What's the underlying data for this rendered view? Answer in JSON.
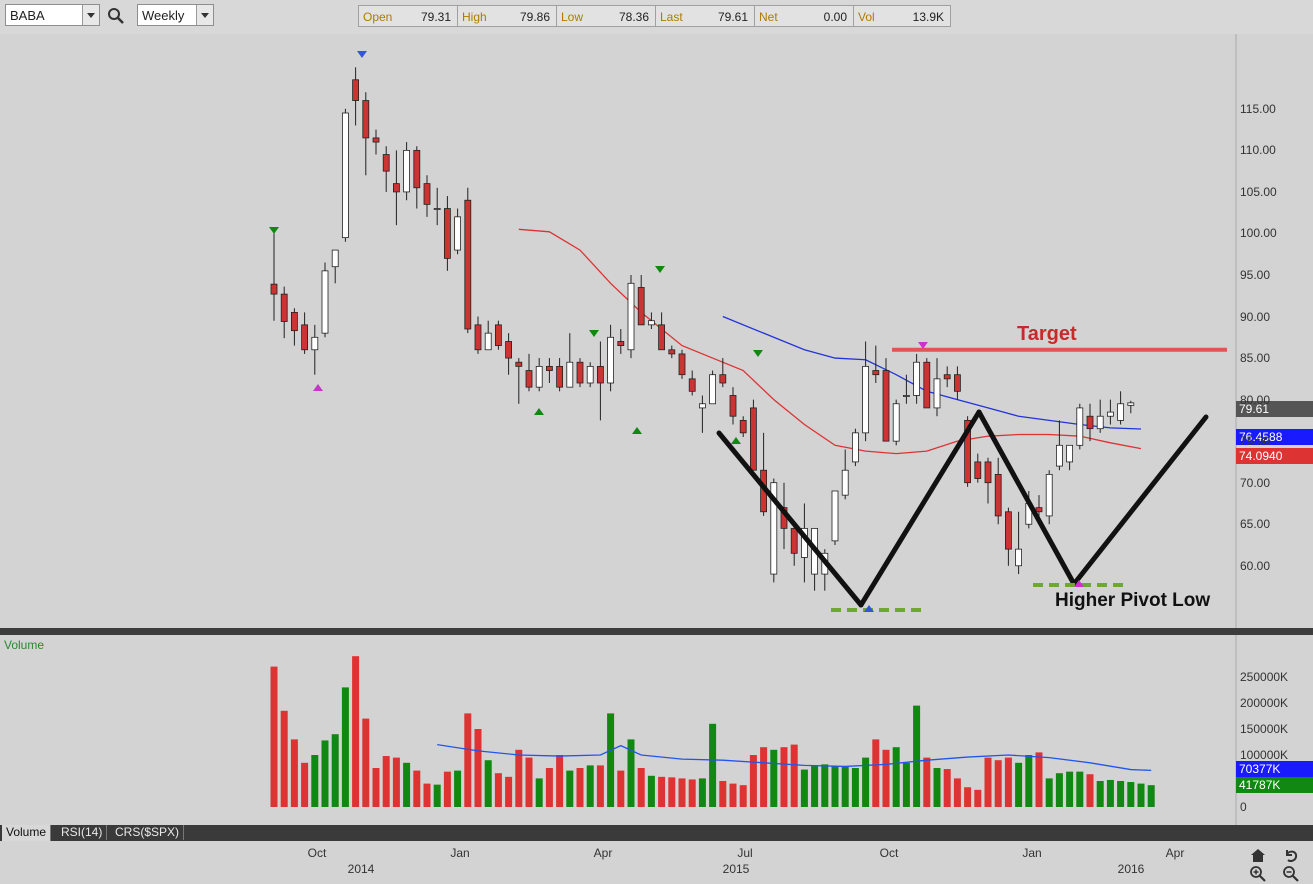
{
  "toolbar": {
    "symbol": "BABA",
    "period": "Weekly",
    "quote": [
      {
        "label": "Open",
        "value": "79.31"
      },
      {
        "label": "High",
        "value": "79.86"
      },
      {
        "label": "Low",
        "value": "78.36"
      },
      {
        "label": "Last",
        "value": "79.61"
      },
      {
        "label": "Net",
        "value": "0.00"
      },
      {
        "label": "Vol",
        "value": "13.9K"
      }
    ]
  },
  "colors": {
    "up": "#ffffff",
    "down": "#cc3333",
    "ma_blue": "#2233dd",
    "ma_red": "#dd3333",
    "vol_up": "#118811",
    "vol_down": "#dd3333",
    "target_line": "#e05555",
    "pivot_dash": "#6ea832"
  },
  "price_axis": {
    "ticks": [
      "115.00",
      "110.00",
      "105.00",
      "100.00",
      "95.00",
      "90.00",
      "85.00",
      "80.00",
      "75.00",
      "70.00",
      "65.00",
      "60.00"
    ],
    "min": 56,
    "max": 121
  },
  "price_tags": {
    "last": "79.61",
    "ma_blue": "76.4588",
    "ma_red": "74.0940"
  },
  "volume_panel": {
    "title": "Volume",
    "ticks": [
      "250000K",
      "200000K",
      "150000K",
      "100000K",
      "0"
    ],
    "avg_tag": "70377K",
    "last_tag": "41787K",
    "max": 300000
  },
  "annotations": {
    "target": "Target",
    "pivot": "Higher Pivot Low"
  },
  "tabs": [
    "Volume",
    "RSI(14)",
    "CRS($SPX)"
  ],
  "time_axis": {
    "months": [
      "Oct",
      "Jan",
      "Apr",
      "Jul",
      "Oct",
      "Jan",
      "Apr"
    ],
    "years": [
      "2014",
      "2015",
      "2016"
    ]
  },
  "icons": [
    "search-icon",
    "home-icon",
    "undo-icon",
    "zoom-in-icon",
    "zoom-out-icon"
  ],
  "chart_data": {
    "type": "candlestick",
    "x_labels": [
      "Oct",
      "Jan",
      "Apr",
      "Jul",
      "Oct",
      "Jan",
      "Apr"
    ],
    "ohlc": [
      [
        93.9,
        100.0,
        89.5,
        92.7
      ],
      [
        92.7,
        93.6,
        87.4,
        89.4
      ],
      [
        90.5,
        91.0,
        86.5,
        88.3
      ],
      [
        89.0,
        90.5,
        85.5,
        86.0
      ],
      [
        86.0,
        89.0,
        83.0,
        87.5
      ],
      [
        88.0,
        96.5,
        87.5,
        95.5
      ],
      [
        96.0,
        97.5,
        94.0,
        98.0
      ],
      [
        99.5,
        115.0,
        99.0,
        114.5
      ],
      [
        118.5,
        120.0,
        113.0,
        116.0
      ],
      [
        116.0,
        117.0,
        107.0,
        111.5
      ],
      [
        111.5,
        112.5,
        109.5,
        111.0
      ],
      [
        109.5,
        110.5,
        105.0,
        107.5
      ],
      [
        106.0,
        110.0,
        101.0,
        105.0
      ],
      [
        105.0,
        111.0,
        104.0,
        110.0
      ],
      [
        110.0,
        110.5,
        103.0,
        105.5
      ],
      [
        106.0,
        107.0,
        102.0,
        103.5
      ],
      [
        103.0,
        105.5,
        101.0,
        103.0
      ],
      [
        103.0,
        104.5,
        95.5,
        97.0
      ],
      [
        98.0,
        103.0,
        97.5,
        102.0
      ],
      [
        104.0,
        105.5,
        88.0,
        88.5
      ],
      [
        89.0,
        90.0,
        85.5,
        86.0
      ],
      [
        86.0,
        89.5,
        86.0,
        88.0
      ],
      [
        89.0,
        89.5,
        86.0,
        86.5
      ],
      [
        87.0,
        88.0,
        83.0,
        85.0
      ],
      [
        84.5,
        85.0,
        79.5,
        84.0
      ],
      [
        83.5,
        85.5,
        81.0,
        81.5
      ],
      [
        81.5,
        85.0,
        81.0,
        84.0
      ],
      [
        84.0,
        85.0,
        82.0,
        83.5
      ],
      [
        84.0,
        85.0,
        81.0,
        81.5
      ],
      [
        81.5,
        88.0,
        81.5,
        84.5
      ],
      [
        84.5,
        85.0,
        81.5,
        82.0
      ],
      [
        82.0,
        84.5,
        81.5,
        84.0
      ],
      [
        84.0,
        87.0,
        77.5,
        82.0
      ],
      [
        82.0,
        89.0,
        81.0,
        87.5
      ],
      [
        87.0,
        88.5,
        85.5,
        86.5
      ],
      [
        86.0,
        95.0,
        85.0,
        94.0
      ],
      [
        93.5,
        95.0,
        89.5,
        89.0
      ],
      [
        89.0,
        90.5,
        88.5,
        89.5
      ],
      [
        89.0,
        90.5,
        86.5,
        86.0
      ],
      [
        86.0,
        86.5,
        85.0,
        85.5
      ],
      [
        85.5,
        86.0,
        82.5,
        83.0
      ],
      [
        82.5,
        83.5,
        80.5,
        81.0
      ],
      [
        79.0,
        80.5,
        76.0,
        79.5
      ],
      [
        79.5,
        83.5,
        79.5,
        83.0
      ],
      [
        83.0,
        85.0,
        81.5,
        82.0
      ],
      [
        80.5,
        81.5,
        77.0,
        78.0
      ],
      [
        77.5,
        78.0,
        75.5,
        76.0
      ],
      [
        79.0,
        80.0,
        71.5,
        71.5
      ],
      [
        71.5,
        76.0,
        66.0,
        66.5
      ],
      [
        59.0,
        70.5,
        58.0,
        70.0
      ],
      [
        67.0,
        70.0,
        62.0,
        64.5
      ],
      [
        64.5,
        65.0,
        60.0,
        61.5
      ],
      [
        61.0,
        67.5,
        58.0,
        64.5
      ],
      [
        59.0,
        64.5,
        57.0,
        64.5
      ],
      [
        59.0,
        62.0,
        57.0,
        61.5
      ],
      [
        63.0,
        69.0,
        62.5,
        69.0
      ],
      [
        68.5,
        74.0,
        68.0,
        71.5
      ],
      [
        72.5,
        76.5,
        72.0,
        76.0
      ],
      [
        76.0,
        87.0,
        75.0,
        84.0
      ],
      [
        83.5,
        86.5,
        82.0,
        83.0
      ],
      [
        83.5,
        85.0,
        75.0,
        75.0
      ],
      [
        75.0,
        80.0,
        74.5,
        79.5
      ],
      [
        80.5,
        83.0,
        79.5,
        80.5
      ],
      [
        80.5,
        85.5,
        79.5,
        84.5
      ],
      [
        84.5,
        85.0,
        79.0,
        79.0
      ],
      [
        79.0,
        85.0,
        78.0,
        82.5
      ],
      [
        83.0,
        84.0,
        81.5,
        82.5
      ],
      [
        83.0,
        84.0,
        80.0,
        81.0
      ],
      [
        77.5,
        78.0,
        69.5,
        70.0
      ],
      [
        72.5,
        73.5,
        70.0,
        70.5
      ],
      [
        72.5,
        73.0,
        67.5,
        70.0
      ],
      [
        71.0,
        73.0,
        65.0,
        66.0
      ],
      [
        66.5,
        67.0,
        60.0,
        62.0
      ],
      [
        60.0,
        66.5,
        59.0,
        62.0
      ],
      [
        65.0,
        69.0,
        64.5,
        67.5
      ],
      [
        67.0,
        68.5,
        65.0,
        66.5
      ],
      [
        66.0,
        71.5,
        65.0,
        71.0
      ],
      [
        72.0,
        77.5,
        71.5,
        74.5
      ],
      [
        72.5,
        74.0,
        71.5,
        74.5
      ],
      [
        74.5,
        79.5,
        74.0,
        79.0
      ],
      [
        78.0,
        79.5,
        75.0,
        76.5
      ],
      [
        76.5,
        80.0,
        76.0,
        78.0
      ],
      [
        78.0,
        80.0,
        77.0,
        78.5
      ],
      [
        77.5,
        81.0,
        77.0,
        79.5
      ],
      [
        79.31,
        79.86,
        78.36,
        79.61
      ]
    ],
    "ma_red": [
      [
        24,
        100.5
      ],
      [
        27,
        100.2
      ],
      [
        30,
        98.0
      ],
      [
        33,
        94.0
      ],
      [
        36,
        90.5
      ],
      [
        38,
        88.5
      ],
      [
        40,
        86.5
      ],
      [
        43,
        85.0
      ],
      [
        46,
        83.5
      ],
      [
        49,
        80.0
      ],
      [
        52,
        77.0
      ],
      [
        55,
        74.5
      ],
      [
        58,
        73.8
      ],
      [
        61,
        73.5
      ],
      [
        64,
        73.8
      ],
      [
        67,
        75.0
      ],
      [
        70,
        75.6
      ],
      [
        73,
        75.8
      ],
      [
        76,
        75.8
      ],
      [
        79,
        75.6
      ],
      [
        82,
        74.8
      ],
      [
        85,
        74.1
      ]
    ],
    "ma_blue": [
      [
        44,
        90.0
      ],
      [
        48,
        88.0
      ],
      [
        52,
        86.0
      ],
      [
        55,
        85.0
      ],
      [
        58,
        84.8
      ],
      [
        61,
        83.0
      ],
      [
        64,
        81.0
      ],
      [
        67,
        80.0
      ],
      [
        70,
        79.0
      ],
      [
        73,
        78.0
      ],
      [
        76,
        77.5
      ],
      [
        79,
        77.0
      ],
      [
        82,
        76.6
      ],
      [
        85,
        76.4588
      ]
    ],
    "volume": [
      270,
      185,
      130,
      85,
      100,
      128,
      140,
      230,
      290,
      170,
      75,
      98,
      95,
      85,
      70,
      45,
      43,
      68,
      70,
      180,
      150,
      90,
      65,
      58,
      110,
      95,
      55,
      75,
      100,
      70,
      75,
      80,
      80,
      180,
      70,
      130,
      75,
      60,
      58,
      57,
      55,
      53,
      55,
      160,
      50,
      45,
      42,
      100,
      115,
      110,
      115,
      120,
      72,
      80,
      82,
      78,
      78,
      75,
      95,
      130,
      110,
      115,
      85,
      195,
      95,
      75,
      73,
      55,
      38,
      33,
      95,
      90,
      95,
      85,
      100,
      105,
      55,
      65,
      68,
      68,
      63,
      50,
      52,
      50,
      48,
      45,
      42
    ],
    "volume_avg": [
      [
        16,
        120
      ],
      [
        20,
        108
      ],
      [
        24,
        100
      ],
      [
        28,
        98
      ],
      [
        32,
        100
      ],
      [
        34,
        118
      ],
      [
        36,
        100
      ],
      [
        40,
        92
      ],
      [
        44,
        90
      ],
      [
        48,
        85
      ],
      [
        52,
        80
      ],
      [
        56,
        78
      ],
      [
        60,
        82
      ],
      [
        64,
        90
      ],
      [
        68,
        96
      ],
      [
        72,
        100
      ],
      [
        76,
        95
      ],
      [
        80,
        85
      ],
      [
        84,
        72
      ],
      [
        86,
        70.377
      ]
    ]
  }
}
